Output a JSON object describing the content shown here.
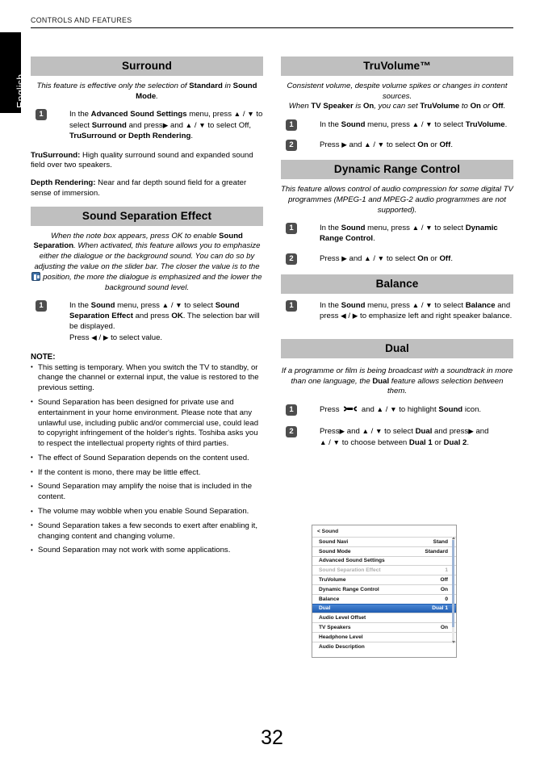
{
  "header": {
    "running_head": "CONTROLS AND FEATURES"
  },
  "side_tab": {
    "language": "English"
  },
  "page_number": "32",
  "left_column": {
    "surround": {
      "title": "Surround",
      "intro_html": "This feature is effective only the selection of <b>Standard</b> in <b>Sound Mode</b>.",
      "steps": [
        {
          "num": "1",
          "html": "In the <b>Advanced Sound Settings</b> menu, press <span class=\"arr\">▲</span> / <span class=\"arr\">▼</span> to select <b>Surround</b> and press<span class=\"arr\">▶</span> and <span class=\"arr\">▲</span> / <span class=\"arr\">▼</span> to select Off, <b>TruSurround or Depth Rendering</b>."
        }
      ],
      "paragraphs": [
        "<b>TruSurround:</b> High quality surround sound and expanded sound field over two speakers.",
        "<b>Depth Rendering:</b> Near and far depth sound field for a greater sense of immersion."
      ]
    },
    "sound_separation": {
      "title": "Sound Separation Effect",
      "intro_html": "When the note box appears, press OK to enable <b>Sound Separation</b>. When activated, this feature allows you to emphasize either the dialogue or the background sound. You can do so by adjusting the value on the slider bar. The closer the value is to the <span class=\"ico-dialogue\" data-name=\"dialogue-icon\"></span> position, the more the dialogue is emphasized and the lower the background sound level.",
      "steps": [
        {
          "num": "1",
          "html": "In the <b>Sound</b> menu, press <span class=\"arr\">▲</span> / <span class=\"arr\">▼</span> to select <b>Sound Separation Effect</b> and press <b>OK</b>. The selection bar will be displayed.<br>Press <span class=\"arr\">◀</span> / <span class=\"arr\">▶</span> to select value."
        }
      ],
      "note_title": "NOTE:",
      "notes": [
        "This setting is temporary. When you switch the TV to standby, or change the channel or external input, the value is restored to the previous setting.",
        "Sound Separation has been designed for private use and entertainment in your home environment. Please note that any unlawful use, including public and/or commercial use, could lead to copyright infringement of the holder's rights. Toshiba asks you to respect the intellectual property rights of third parties.",
        "The effect of Sound Separation depends on the content used.",
        "If the content is mono, there may be little effect.",
        "Sound Separation may amplify the noise that is included in the content.",
        "The volume may wobble when you enable Sound Separation.",
        "Sound Separation takes a few seconds to exert after enabling it, changing content and changing volume.",
        "Sound Separation may not work with some applications."
      ]
    }
  },
  "right_column": {
    "truvolume": {
      "title": "TruVolume™",
      "intro_html": "Consistent volume, despite volume spikes or changes in content sources.<br>When <b>TV Speaker</b> is <b>On</b>, you can set <b>TruVolume</b> to <b>On</b> or <b>Off</b>.",
      "steps": [
        {
          "num": "1",
          "html": "In the <b>Sound</b> menu, press <span class=\"arr\">▲</span> / <span class=\"arr\">▼</span> to select <b>TruVolume</b>."
        },
        {
          "num": "2",
          "html": "Press <span class=\"arr\">▶</span> and <span class=\"arr\">▲</span> / <span class=\"arr\">▼</span> to select <b>On</b> or <b>Off</b>."
        }
      ]
    },
    "dynamic_range": {
      "title": "Dynamic Range Control",
      "intro_html": "This feature allows control of audio compression for some digital TV programmes (MPEG-1 and MPEG-2 audio programmes are not supported).",
      "steps": [
        {
          "num": "1",
          "html": "In the <b>Sound</b> menu, press <span class=\"arr\">▲</span> / <span class=\"arr\">▼</span> to select <b>Dynamic Range Control</b>."
        },
        {
          "num": "2",
          "html": "Press <span class=\"arr\">▶</span> and <span class=\"arr\">▲</span> / <span class=\"arr\">▼</span> to select <b>On</b> or <b>Off</b>."
        }
      ]
    },
    "balance": {
      "title": "Balance",
      "steps": [
        {
          "num": "1",
          "html": "In the <b>Sound</b> menu, press <span class=\"arr\">▲</span> / <span class=\"arr\">▼</span> to select <b>Balance</b> and press <span class=\"arr\">◀</span> / <span class=\"arr\">▶</span> to emphasize left and right speaker balance."
        }
      ]
    },
    "dual": {
      "title": "Dual",
      "intro_html": "If a programme or film is being broadcast with a soundtrack in more than one language, the <b>Dual</b> feature allows selection between them.",
      "steps": [
        {
          "num": "1",
          "html": "Press <span class=\"ico-wrench\" data-name=\"wrench-icon\"><svg width=\"22\" height=\"9\" viewBox=\"0 0 44 18\"><path d=\"M6 9 L16 6 L16 12 Z M16 6 L28 6 L28 12 L16 12 Z M28 9 L38 6 L38 12 Z\" fill=\"#000\"/><circle cx=\"7\" cy=\"9\" r=\"6\" fill=\"#000\"/><circle cx=\"7\" cy=\"9\" r=\"2.6\" fill=\"#fff\"/><circle cx=\"37\" cy=\"9\" r=\"6\" fill=\"#000\"/><circle cx=\"37\" cy=\"9\" r=\"2.6\" fill=\"#fff\"/><rect x=\"0\" y=\"3\" width=\"6\" height=\"12\" fill=\"#fff\"/><rect x=\"38\" y=\"3\" width=\"6\" height=\"12\" fill=\"#fff\"/></svg></span> and <span class=\"arr\">▲</span> / <span class=\"arr\">▼</span> to highlight <b>Sound</b> icon."
        },
        {
          "num": "2",
          "html": "Press<span class=\"arr\">▶</span> and <span class=\"arr\">▲</span> / <span class=\"arr\">▼</span> to select <b>Dual</b> and press<span class=\"arr\">▶</span> and <br><span class=\"arr\">▲</span> / <span class=\"arr\">▼</span> to choose between <b>Dual 1</b> or <b>Dual 2</b>."
        }
      ]
    }
  },
  "tv_menu": {
    "breadcrumb": "< Sound",
    "rows": [
      {
        "label": "Sound Navi",
        "value": "Stand",
        "state": "normal"
      },
      {
        "label": "Sound Mode",
        "value": "Standard",
        "state": "normal"
      },
      {
        "label": "Advanced Sound Settings",
        "value": "",
        "state": "normal"
      },
      {
        "label": "Sound Separation Effect",
        "value": "1",
        "state": "dim"
      },
      {
        "label": "TruVolume",
        "value": "Off",
        "state": "normal"
      },
      {
        "label": "Dynamic Range Control",
        "value": "On",
        "state": "normal"
      },
      {
        "label": "Balance",
        "value": "0",
        "state": "normal"
      },
      {
        "label": "Dual",
        "value": "Dual 1",
        "state": "selected"
      },
      {
        "label": "Audio Level Offset",
        "value": "",
        "state": "normal"
      },
      {
        "label": "TV Speakers",
        "value": "On",
        "state": "normal"
      },
      {
        "label": "Headphone Level",
        "value": "",
        "state": "normal"
      },
      {
        "label": "Audio Description",
        "value": "",
        "state": "normal"
      }
    ]
  },
  "colors": {
    "section_bar": "#bfbfbf",
    "step_badge": "#4d4d4d",
    "menu_selected": "#2f6fc4",
    "tab_background": "#000000"
  }
}
